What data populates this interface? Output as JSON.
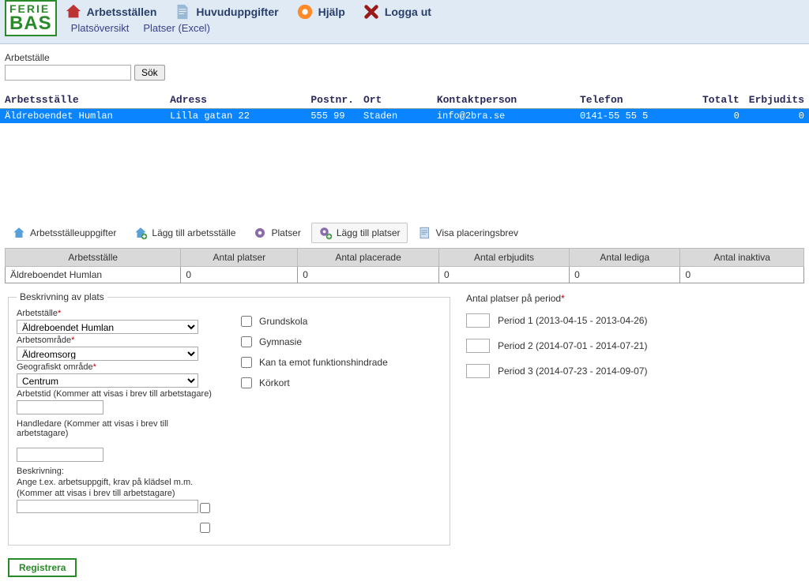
{
  "logo": {
    "line1": "FERIE",
    "line2": "BAS"
  },
  "nav": {
    "arbetsstallen": "Arbetsställen",
    "huvuduppgifter": "Huvuduppgifter",
    "hjalp": "Hjälp",
    "loggaut": "Logga ut",
    "platsoversikt": "Platsöversikt",
    "platser_excel": "Platser (Excel)"
  },
  "search": {
    "label": "Arbetställe",
    "value": "",
    "button": "Sök"
  },
  "grid1": {
    "cols": {
      "arbetsstalle": "Arbetsställe",
      "adress": "Adress",
      "postnr": "Postnr.",
      "ort": "Ort",
      "kontaktperson": "Kontaktperson",
      "telefon": "Telefon",
      "totalt": "Totalt",
      "erbjudits": "Erbjudits"
    },
    "row": {
      "arbetsstalle": "Äldreboendet Humlan",
      "adress": "Lilla gatan 22",
      "postnr": "555 99",
      "ort": "Staden",
      "kontaktperson": "info@2bra.se",
      "telefon": "0141-55 55 5",
      "totalt": "0",
      "erbjudits": "0"
    }
  },
  "toolbar": {
    "uppgifter": "Arbetsställeuppgifter",
    "lagg_arb": "Lägg till arbetsställe",
    "platser": "Platser",
    "lagg_plats": "Lägg till platser",
    "visa_brev": "Visa placeringsbrev"
  },
  "grid2": {
    "cols": {
      "arbetsstalle": "Arbetsställe",
      "antal_platser": "Antal platser",
      "antal_placerade": "Antal placerade",
      "antal_erbjudits": "Antal erbjudits",
      "antal_lediga": "Antal lediga",
      "antal_inaktiva": "Antal inaktiva"
    },
    "row": {
      "arbetsstalle": "Äldreboendet Humlan",
      "antal_platser": "0",
      "antal_placerade": "0",
      "antal_erbjudits": "0",
      "antal_lediga": "0",
      "antal_inaktiva": "0"
    }
  },
  "form": {
    "legend": "Beskrivning av plats",
    "arbetsstalle_lbl": "Arbetställe",
    "arbetsstalle_val": "Äldreboendet Humlan",
    "arbetsomrade_lbl": "Arbetsområde",
    "arbetsomrade_val": "Äldreomsorg",
    "geografiskt_lbl": "Geografiskt område",
    "geografiskt_val": "Centrum",
    "arbetstid_lbl": "Arbetstid (Kommer att visas i brev till arbetstagare)",
    "handledare_lbl": "Handledare (Kommer att visas i brev till arbetstagare)",
    "beskrivning_lbl1": "Beskrivning:",
    "beskrivning_lbl2": "Ange t.ex. arbetsuppgift, krav på klädsel m.m.",
    "beskrivning_lbl3": "(Kommer att visas i brev till arbetstagare)",
    "chk_grundskola": "Grundskola",
    "chk_gymnasie": "Gymnasie",
    "chk_funktion": "Kan ta emot funktionshindrade",
    "chk_korkort": "Körkort",
    "periods_legend": "Antal platser på period",
    "period1": "Period 1 (2013-04-15 - 2013-04-26)",
    "period2": "Period 2 (2014-07-01 - 2014-07-21)",
    "period3": "Period 3 (2014-07-23 - 2014-09-07)",
    "register": "Registrera"
  }
}
